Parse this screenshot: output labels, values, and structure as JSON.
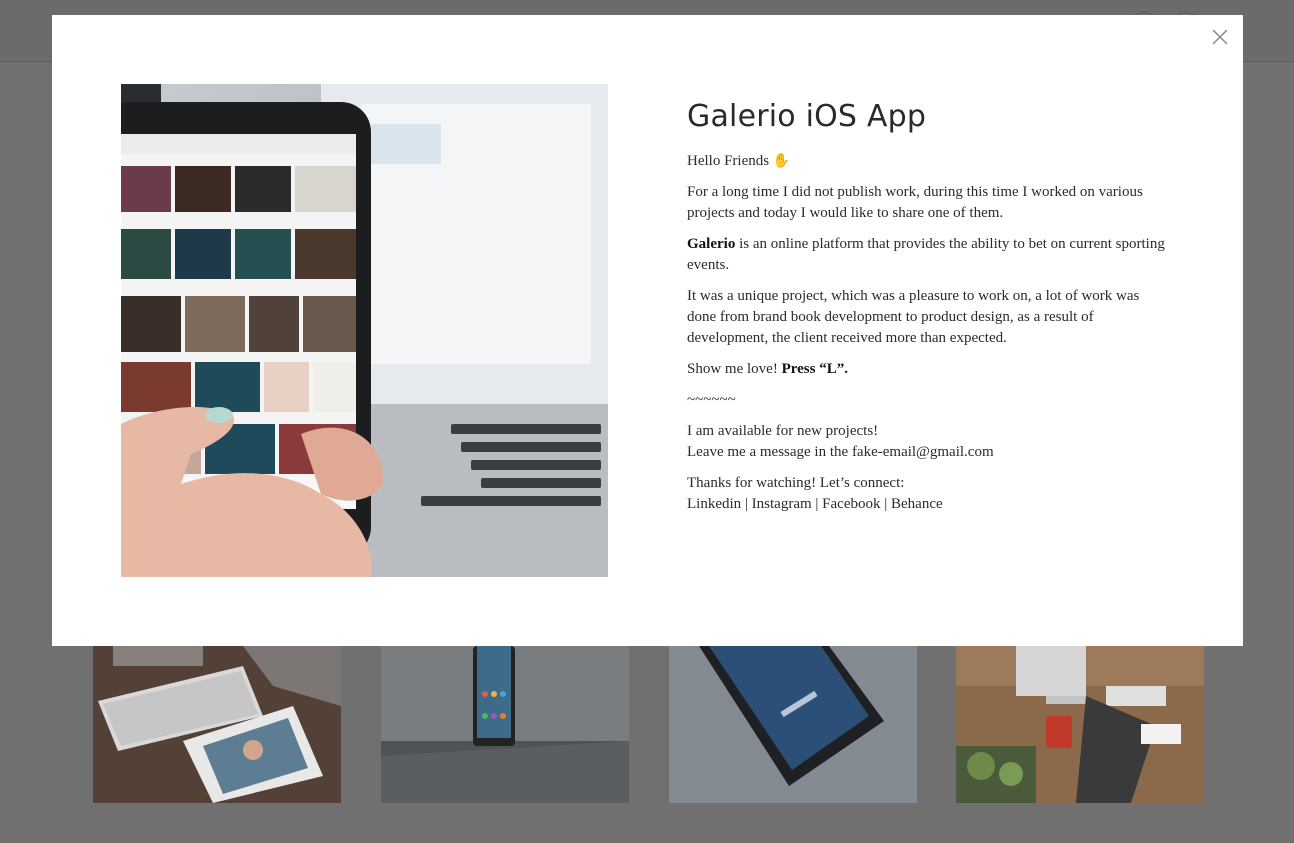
{
  "modal": {
    "title": "Galerio iOS App",
    "greeting": "Hello Friends",
    "wave_icon": "waving-hand-icon",
    "paragraph1": "For a long time I did not publish work, during this time I worked on various projects and today I would like to share one of them.",
    "brand_bold": "Galerio",
    "paragraph2_rest": " is an online platform that provides the ability to bet on current sporting events.",
    "paragraph3": "It was a unique project, which was a pleasure to work on, a lot of work was done from brand book development to product design, as a result of development, the client received more than expected.",
    "love_prefix": "Show me love! ",
    "love_bold": "Press “L”.",
    "separator": "~~~~~~",
    "available": "I am available for new projects!",
    "message_prefix": "Leave me a message in the ",
    "email": "fake-email@gmail.com",
    "thanks": "Thanks for watching! Let’s connect:",
    "social": [
      "Linkedin",
      "Instagram",
      "Facebook",
      "Behance"
    ],
    "social_sep": " | ",
    "close_icon": "close-icon"
  },
  "colors": {
    "overlay": "#6f6f6f",
    "modal_bg": "#ffffff",
    "text": "#2b2b2b"
  }
}
